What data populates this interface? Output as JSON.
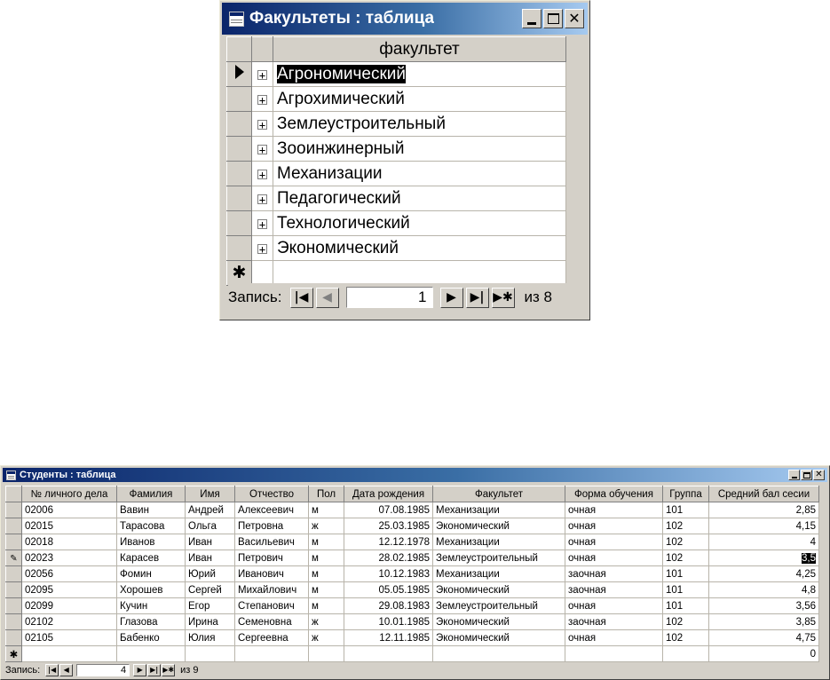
{
  "faculties_window": {
    "title": "Факультеты : таблица",
    "column_header": "факультет",
    "rows": [
      {
        "name": "Агрономический",
        "expand": "+"
      },
      {
        "name": "Агрохимический",
        "expand": "+"
      },
      {
        "name": "Землеустроительный",
        "expand": "+"
      },
      {
        "name": "Зооинжинерный",
        "expand": "+"
      },
      {
        "name": "Механизации",
        "expand": "+"
      },
      {
        "name": "Педагогический",
        "expand": "+"
      },
      {
        "name": "Технологический",
        "expand": "+"
      },
      {
        "name": "Экономический",
        "expand": "+"
      }
    ],
    "new_row_marker": "✱",
    "nav": {
      "label": "Запись:",
      "current": "1",
      "of_label": "из 8",
      "first": "|◀",
      "prev": "◀",
      "next": "▶",
      "last": "▶|",
      "new": "▶✱"
    }
  },
  "students_window": {
    "title": "Студенты : таблица",
    "columns": [
      "№ личного дела",
      "Фамилия",
      "Имя",
      "Отчество",
      "Пол",
      "Дата рождения",
      "Факультет",
      "Форма обучения",
      "Группа",
      "Средний бал сесии"
    ],
    "rows": [
      [
        "02006",
        "Вавин",
        "Андрей",
        "Алексеевич",
        "м",
        "07.08.1985",
        "Механизации",
        "очная",
        "101",
        "2,85"
      ],
      [
        "02015",
        "Тарасова",
        "Ольга",
        "Петровна",
        "ж",
        "25.03.1985",
        "Экономический",
        "очная",
        "102",
        "4,15"
      ],
      [
        "02018",
        "Иванов",
        "Иван",
        "Васильевич",
        "м",
        "12.12.1978",
        "Механизации",
        "очная",
        "102",
        "4"
      ],
      [
        "02023",
        "Карасев",
        "Иван",
        "Петрович",
        "м",
        "28.02.1985",
        "Землеустроительный",
        "очная",
        "102",
        "3,5"
      ],
      [
        "02056",
        "Фомин",
        "Юрий",
        "Иванович",
        "м",
        "10.12.1983",
        "Механизации",
        "заочная",
        "101",
        "4,25"
      ],
      [
        "02095",
        "Хорошев",
        "Сергей",
        "Михайлович",
        "м",
        "05.05.1985",
        "Экономический",
        "заочная",
        "101",
        "4,8"
      ],
      [
        "02099",
        "Кучин",
        "Егор",
        "Степанович",
        "м",
        "29.08.1983",
        "Землеустроительный",
        "очная",
        "101",
        "3,56"
      ],
      [
        "02102",
        "Глазова",
        "Ирина",
        "Семеновна",
        "ж",
        "10.01.1985",
        "Экономический",
        "заочная",
        "102",
        "3,85"
      ],
      [
        "02105",
        "Бабенко",
        "Юлия",
        "Сергеевна",
        "ж",
        "12.11.1985",
        "Экономический",
        "очная",
        "102",
        "4,75"
      ]
    ],
    "new_row_marker": "✱",
    "new_row_default": "0",
    "editing_marker": "✎",
    "nav": {
      "label": "Запись:",
      "current": "4",
      "of_label": "из 9",
      "first": "|◀",
      "prev": "◀",
      "next": "▶",
      "last": "▶|",
      "new": "▶✱"
    }
  },
  "colors": {
    "title_active_start": "#0a246a",
    "title_active_end": "#a6caf0",
    "face": "#d4d0c8"
  }
}
